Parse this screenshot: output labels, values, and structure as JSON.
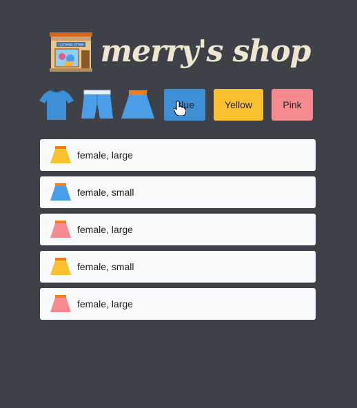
{
  "header": {
    "title": "merry's shop",
    "logo_icon": "clothing-store-icon",
    "logo_sign_text": "CLOTHING STORE"
  },
  "filters": {
    "category_icons": [
      "tshirt-icon",
      "shorts-icon",
      "skirt-icon"
    ],
    "colors": [
      {
        "label": "Blue",
        "color": "#3d8fd6"
      },
      {
        "label": "Yellow",
        "color": "#fbc02d"
      },
      {
        "label": "Pink",
        "color": "#f78a8f"
      }
    ]
  },
  "items": [
    {
      "label": "female, large",
      "icon": "skirt-icon",
      "color": "#fbc02d"
    },
    {
      "label": "female, small",
      "icon": "skirt-icon",
      "color": "#4a9ee8"
    },
    {
      "label": "female, large",
      "icon": "skirt-icon",
      "color": "#f78a8f"
    },
    {
      "label": "female, small",
      "icon": "skirt-icon",
      "color": "#fbc02d"
    },
    {
      "label": "female, large",
      "icon": "skirt-icon",
      "color": "#f78a8f"
    }
  ]
}
